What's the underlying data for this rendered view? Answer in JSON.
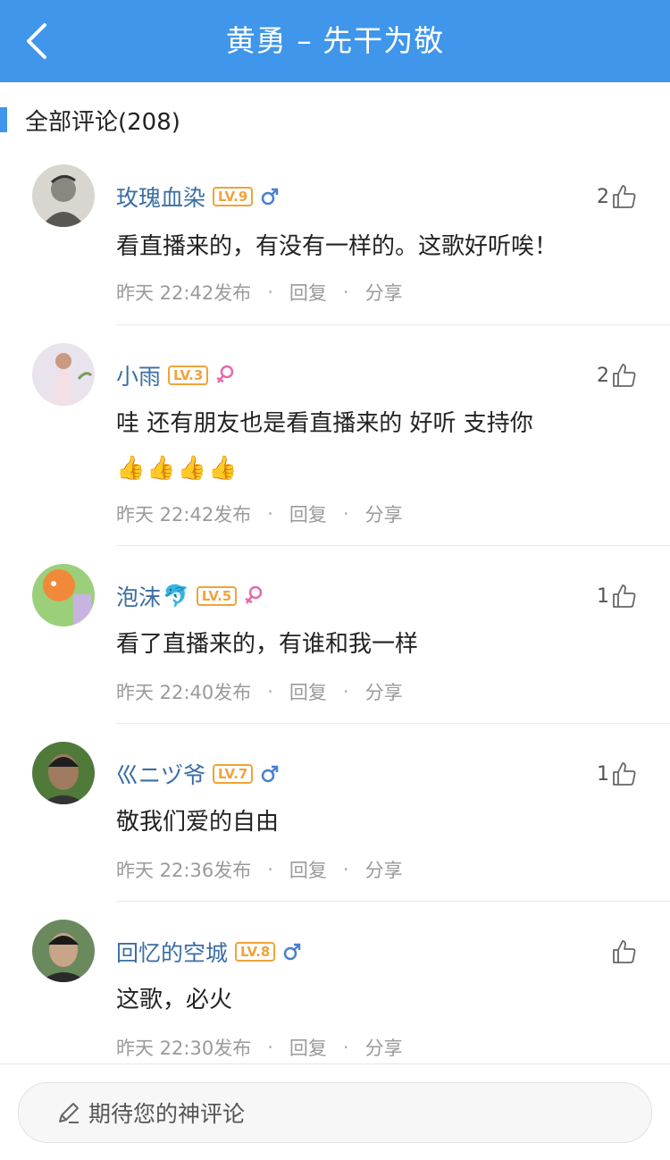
{
  "header": {
    "title": "黄勇 – 先干为敬",
    "back_icon": "chevron-left-icon"
  },
  "section": {
    "title": "全部评论(208)"
  },
  "comments": [
    {
      "user": "玫瑰血染",
      "level": "LV.9",
      "gender": "male",
      "likes": "2",
      "text": "看直播来的，有没有一样的。这歌好听唉！",
      "time": "昨天 22:42发布",
      "reply": "回复",
      "share": "分享",
      "sep": "·"
    },
    {
      "user": "小雨",
      "level": "LV.3",
      "gender": "female",
      "likes": "2",
      "text": "哇 还有朋友也是看直播来的 好听   支持你",
      "emoji": "👍👍👍👍",
      "time": "昨天 22:42发布",
      "reply": "回复",
      "share": "分享",
      "sep": "·"
    },
    {
      "user": "泡沫",
      "user_emoji": "🐬",
      "level": "LV.5",
      "gender": "female",
      "likes": "1",
      "text": "看了直播来的，有谁和我一样",
      "time": "昨天 22:40发布",
      "reply": "回复",
      "share": "分享",
      "sep": "·"
    },
    {
      "user": "巛ニヅ爷",
      "level": "LV.7",
      "gender": "male",
      "likes": "1",
      "text": "敬我们爱的自由",
      "time": "昨天 22:36发布",
      "reply": "回复",
      "share": "分享",
      "sep": "·"
    },
    {
      "user": "回忆的空城",
      "level": "LV.8",
      "gender": "male",
      "likes": "",
      "text": "这歌，必火",
      "time": "昨天 22:30发布",
      "reply": "回复",
      "share": "分享",
      "sep": "·"
    }
  ],
  "composer": {
    "placeholder": "期待您的神评论",
    "icon": "pencil-icon"
  },
  "colors": {
    "brand": "#3f96ea",
    "username": "#3a6ea5",
    "level": "#f0a33a",
    "male": "#4a7fd0",
    "female": "#e86aa8"
  }
}
